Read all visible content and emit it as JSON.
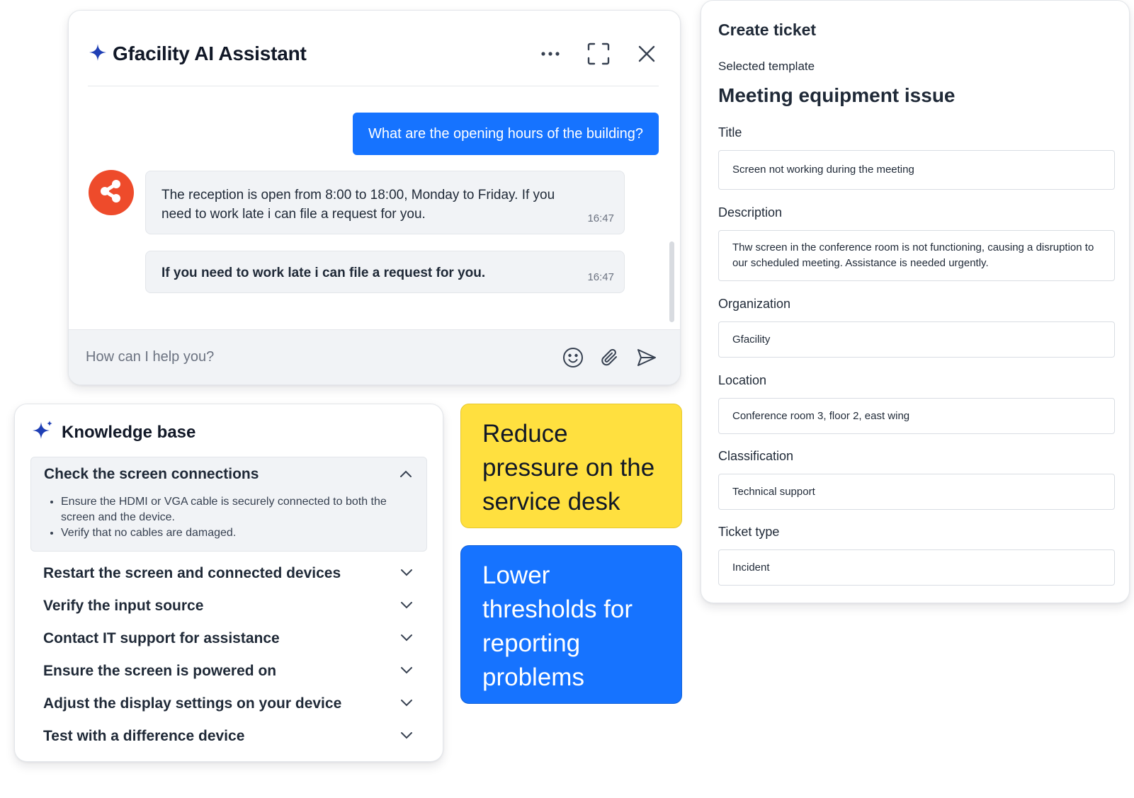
{
  "chat": {
    "title": "Gfacility AI Assistant",
    "user_message": "What are the opening hours of the building?",
    "bot_messages": [
      {
        "text": "The reception is open from 8:00 to 18:00, Monday to Friday. If you need to work late i can file a request for you.",
        "time": "16:47"
      },
      {
        "text": "If you need to work late i can file a request for you.",
        "time": "16:47"
      }
    ],
    "input_placeholder": "How can I help you?",
    "brand_color": "#1673ff",
    "avatar_color": "#ee4b2b"
  },
  "knowledge_base": {
    "title": "Knowledge base",
    "expanded_item": {
      "title": "Check the screen connections",
      "bullets": [
        "Ensure the HDMI or VGA cable is securely connected to both the screen and the device.",
        "Verify that no cables are damaged."
      ]
    },
    "items": [
      "Restart the screen and connected devices",
      "Verify the input source",
      "Contact IT support for assistance",
      "Ensure the screen is powered on",
      "Adjust the display settings on your device",
      "Test with a difference device"
    ]
  },
  "highlights": {
    "yellow": {
      "text": "Reduce pressure on the service desk",
      "color": "#ffe03f"
    },
    "blue": {
      "text": "Lower thresholds for reporting problems",
      "color": "#1673ff"
    }
  },
  "ticket": {
    "title": "Create ticket",
    "selected_template_label": "Selected template",
    "template_name": "Meeting equipment issue",
    "fields": [
      {
        "label": "Title",
        "value": "Screen not working during the meeting"
      },
      {
        "label": "Description",
        "value": "Thw screen in the conference room is not functioning, causing a disruption to our scheduled meeting. Assistance is needed urgently."
      },
      {
        "label": "Organization",
        "value": "Gfacility"
      },
      {
        "label": "Location",
        "value": "Conference room 3, floor 2, east wing"
      },
      {
        "label": "Classification",
        "value": "Technical support"
      },
      {
        "label": "Ticket type",
        "value": "Incident"
      }
    ]
  },
  "icons": {
    "sparkle": "sparkle-icon",
    "more": "more-icon",
    "expand": "expand-icon",
    "close": "close-icon",
    "emoji": "emoji-icon",
    "attach": "paperclip-icon",
    "send": "send-icon",
    "chevron_up": "chevron-up-icon",
    "chevron_down": "chevron-down-icon",
    "share": "share-icon"
  }
}
